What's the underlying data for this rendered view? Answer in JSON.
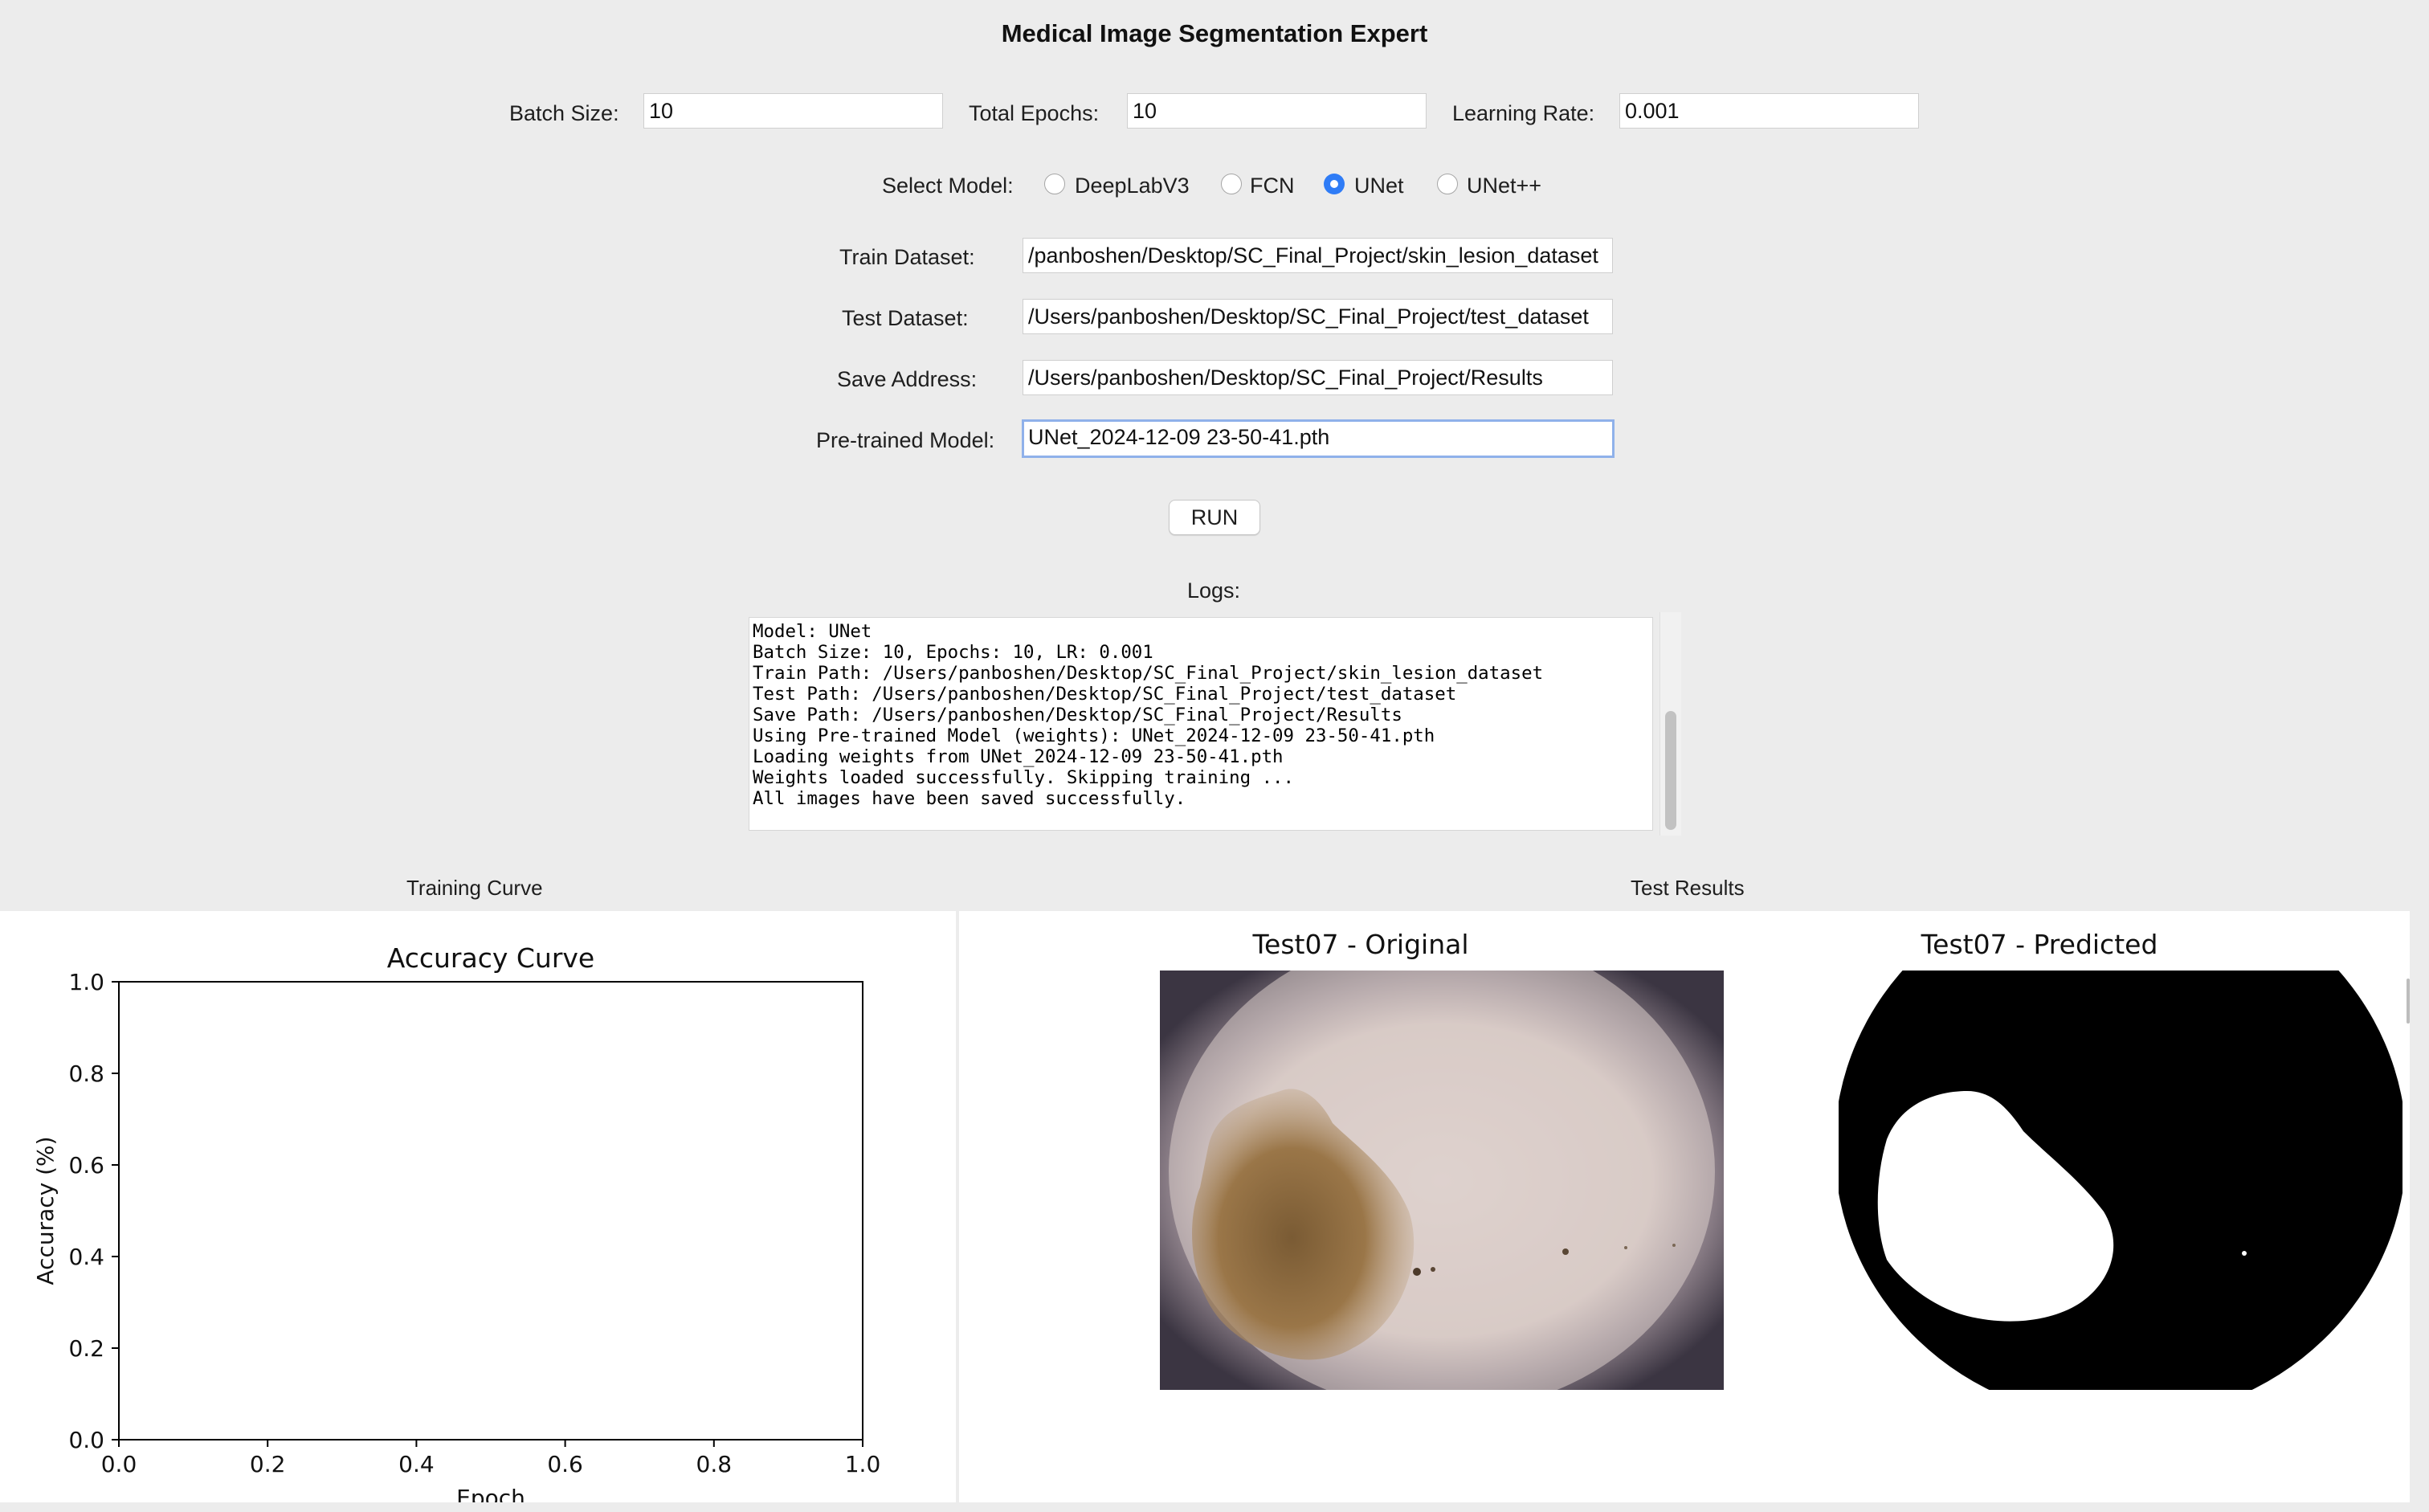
{
  "app": {
    "title": "Medical Image Segmentation Expert"
  },
  "params": {
    "batch_size_label": "Batch Size:",
    "batch_size_value": "10",
    "epochs_label": "Total Epochs:",
    "epochs_value": "10",
    "lr_label": "Learning Rate:",
    "lr_value": "0.001"
  },
  "model_select": {
    "label": "Select Model:",
    "options": [
      {
        "label": "DeepLabV3",
        "selected": false
      },
      {
        "label": "FCN",
        "selected": false
      },
      {
        "label": "UNet",
        "selected": true
      },
      {
        "label": "UNet++",
        "selected": false
      }
    ]
  },
  "paths": {
    "train_label": "Train Dataset:",
    "train_value": "/panboshen/Desktop/SC_Final_Project/skin_lesion_dataset",
    "test_label": "Test Dataset:",
    "test_value": "/Users/panboshen/Desktop/SC_Final_Project/test_dataset",
    "save_label": "Save Address:",
    "save_value": "/Users/panboshen/Desktop/SC_Final_Project/Results",
    "pretrained_label": "Pre-trained Model:",
    "pretrained_value": "UNet_2024-12-09 23-50-41.pth"
  },
  "run_button": "RUN",
  "logs": {
    "label": "Logs:",
    "lines": [
      "Model: UNet",
      "Batch Size: 10, Epochs: 10, LR: 0.001",
      "Train Path: /Users/panboshen/Desktop/SC_Final_Project/skin_lesion_dataset",
      "Test Path: /Users/panboshen/Desktop/SC_Final_Project/test_dataset",
      "Save Path: /Users/panboshen/Desktop/SC_Final_Project/Results",
      "Using Pre-trained Model (weights): UNet_2024-12-09 23-50-41.pth",
      "Loading weights from UNet_2024-12-09 23-50-41.pth",
      "Weights loaded successfully. Skipping training ...",
      "All images have been saved successfully."
    ]
  },
  "training_curve": {
    "section_label": "Training Curve"
  },
  "test_results": {
    "section_label": "Test Results",
    "original_title": "Test07 - Original",
    "predicted_title": "Test07 - Predicted"
  },
  "colors": {
    "accent": "#2f7cf6",
    "background": "#ececec",
    "focus_ring": "#8fb1ea"
  },
  "chart_data": {
    "type": "line",
    "title": "Accuracy Curve",
    "xlabel": "Epoch",
    "ylabel": "Accuracy (%)",
    "xlim": [
      0.0,
      1.0
    ],
    "ylim": [
      0.0,
      1.0
    ],
    "x_ticks": [
      "0.0",
      "0.2",
      "0.4",
      "0.6",
      "0.8",
      "1.0"
    ],
    "y_ticks": [
      "0.0",
      "0.2",
      "0.4",
      "0.6",
      "0.8",
      "1.0"
    ],
    "series": [],
    "grid": false
  }
}
